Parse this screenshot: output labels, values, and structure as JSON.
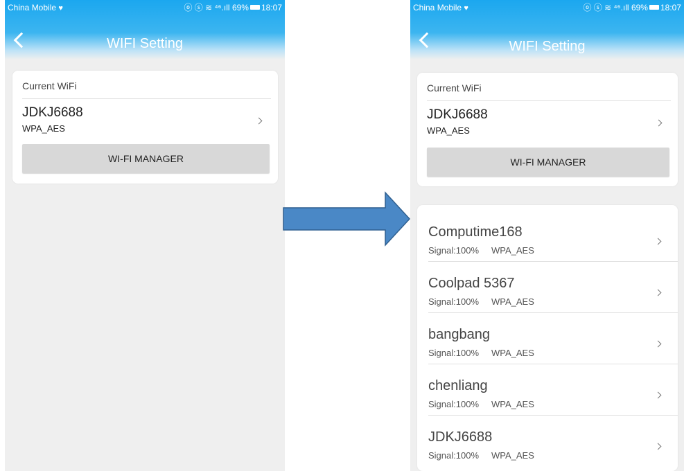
{
  "status_bar": {
    "carrier": "China Mobile",
    "icons": "ⓞ ⓢ ≋ ⁴⁶.ıll",
    "battery": "69%",
    "time": "18:07"
  },
  "header": {
    "title": "WIFI Setting",
    "back_icon": "chevron-left-icon"
  },
  "current_wifi": {
    "label": "Current WiFi",
    "ssid": "JDKJ6688",
    "security": "WPA_AES",
    "manager_button": "WI-FI MANAGER"
  },
  "wifi_list": [
    {
      "ssid": "Computime168",
      "signal": "Signal:100%",
      "security": "WPA_AES"
    },
    {
      "ssid": "Coolpad 5367",
      "signal": "Signal:100%",
      "security": "WPA_AES"
    },
    {
      "ssid": "bangbang",
      "signal": "Signal:100%",
      "security": "WPA_AES"
    },
    {
      "ssid": "chenliang",
      "signal": "Signal:100%",
      "security": "WPA_AES"
    },
    {
      "ssid": "JDKJ6688",
      "signal": "Signal:100%",
      "security": "WPA_AES"
    }
  ],
  "colors": {
    "header_blue": "#1ba7ef",
    "arrow_fill": "#4a88c6",
    "arrow_stroke": "#2f5f8f",
    "background": "#efefef"
  }
}
